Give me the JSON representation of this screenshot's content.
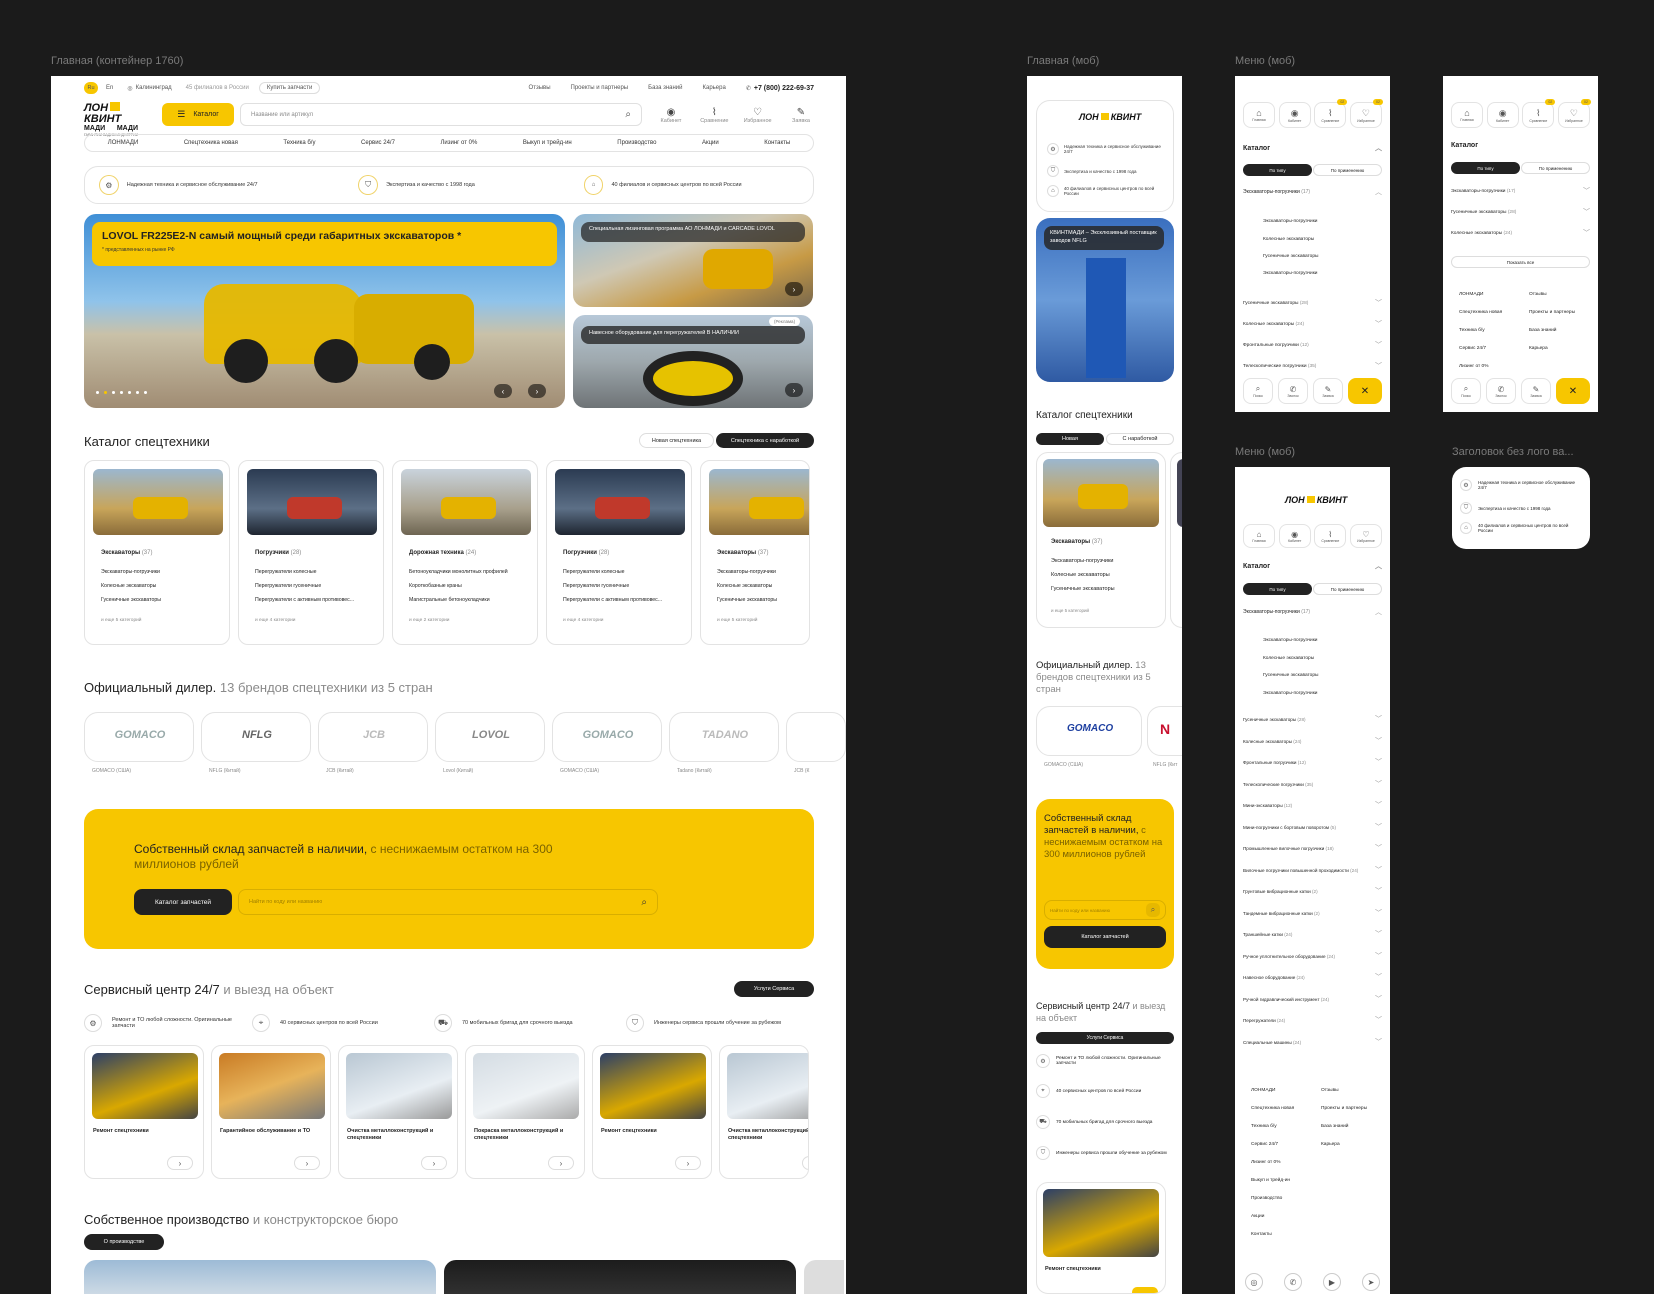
{
  "frame_labels": {
    "main_desktop": "Главная (контейнер 1760)",
    "main_mobile": "Главная (моб)",
    "menu_mobile_1": "Меню (моб)",
    "menu_mobile_2": "Меню (моб)",
    "header_no_logo": "Заголовок без лого ва..."
  },
  "topbar": {
    "lang_ru": "Ru",
    "lang_en": "En",
    "city": "Калининград",
    "branches": "45 филиалов в России",
    "buy_parts": "Купить запчасти",
    "links": [
      "Отзывы",
      "Проекты и партнеры",
      "База знаний",
      "Карьера"
    ],
    "phone": "+7 (800) 222-69-37"
  },
  "logo": {
    "line1": "ЛОН",
    "line2": "МАДИ",
    "line3": "КВИНТ",
    "line4": "МАДИ",
    "tagline": "ГАРАНТИИ ВАДИМ ИНДУСТРИИ"
  },
  "header": {
    "catalog_button": "Каталог",
    "search_placeholder": "Название или артикул",
    "actions": [
      {
        "label": "Кабинет",
        "icon": "user-icon"
      },
      {
        "label": "Сравнение",
        "icon": "chart-icon"
      },
      {
        "label": "Избранное",
        "icon": "heart-icon"
      },
      {
        "label": "Заявка",
        "icon": "request-icon"
      }
    ]
  },
  "nav": [
    "ЛОНМАДИ",
    "Спецтехника новая",
    "Техника б/у",
    "Сервис 24/7",
    "Лизинг от 0%",
    "Выкуп и трейд-ин",
    "Производство",
    "Акции",
    "Контакты"
  ],
  "benefits": [
    "Надежная техника и сервисное обслуживание 24/7",
    "Экспертиза и качество с 1998 года",
    "40 филиалов и сервисных центров по всей России"
  ],
  "hero": {
    "title": "LOVOL FR225E2-N самый мощный среди габаритных экскаваторов *",
    "note": "* представленных на рынке РФ",
    "side1": "Специальная лизинговая программа АО ЛОНМАДИ и CARCADE LOVOL",
    "side2_tag": "Реклама",
    "side2": "Навесное оборудование для перегружателей В НАЛИЧИИ"
  },
  "catalog": {
    "title": "Каталог спецтехники",
    "tab_new": "Новая спецтехника",
    "tab_used": "Спецтехника с наработкой",
    "cards": [
      {
        "title": "Экскаваторы",
        "count": "(37)",
        "items": [
          "Экскаваторы-погрузчики",
          "Колесные экскаваторы",
          "Гусеничные экскаваторы"
        ],
        "more": "и еще 5 категорий"
      },
      {
        "title": "Погрузчики",
        "count": "(28)",
        "items": [
          "Перегружатели колесные",
          "Перегружатели гусеничные",
          "Перегружатели с активным противовес..."
        ],
        "more": "и еще 4 категории"
      },
      {
        "title": "Дорожная техника",
        "count": "(24)",
        "items": [
          "Бетоноукладчики монолитных профилей",
          "Короткобазные краны",
          "Магистральные бетоноукладчики"
        ],
        "more": "и еще 2 категории"
      },
      {
        "title": "Погрузчики",
        "count": "(28)",
        "items": [
          "Перегружатели колесные",
          "Перегружатели гусеничные",
          "Перегружатели с активным противовес..."
        ],
        "more": "и еще 4 категории"
      },
      {
        "title": "Экскаваторы",
        "count": "(37)",
        "items": [
          "Экскаваторы-погрузчики",
          "Колесные экскаваторы",
          "Гусеничные экскаваторы"
        ],
        "more": "и еще 5 категорий"
      }
    ]
  },
  "dealer": {
    "title": "Официальный дилер.",
    "subtitle": "13 брендов спецтехники из 5 стран",
    "brands": [
      {
        "logo": "GOMACO",
        "caption": "GOMACO (США)"
      },
      {
        "logo": "NFLG",
        "caption": "NFLG (Китай)"
      },
      {
        "logo": "JCB",
        "caption": "JCB (Китай)"
      },
      {
        "logo": "LOVOL",
        "caption": "Lovol (Китай)"
      },
      {
        "logo": "GOMACO",
        "caption": "GOMACO (США)"
      },
      {
        "logo": "TADANO",
        "caption": "Tadano (Китай)"
      },
      {
        "logo": "",
        "caption": "JCB (К"
      }
    ]
  },
  "parts": {
    "title": "Собственный склад запчастей в наличии,",
    "subtitle": "с неснижаемым остатком на 300 миллионов рублей",
    "button": "Каталог запчастей",
    "placeholder": "Найти по коду или названию"
  },
  "service": {
    "title": "Сервисный центр 24/7",
    "subtitle": "и выезд на объект",
    "button": "Услуги Сервиса",
    "benefits": [
      "Ремонт и ТО любой сложности. Оригинальные запчасти",
      "40 сервисных центров по всей России",
      "70 мобильных бригад для срочного выезда",
      "Инженеры сервиса прошли обучение за рубежом"
    ],
    "cards": [
      "Ремонт спецтехники",
      "Гарантийное обслуживание и ТО",
      "Очистка металлоконструкций и спецтехники",
      "Покраска металлоконструкций и спецтехники",
      "Ремонт спецтехники",
      "Очистка металлоконструкций и спецтехники"
    ]
  },
  "production": {
    "title": "Собственное производство",
    "subtitle": "и конструкторское бюро",
    "button": "О производстве"
  },
  "mobile": {
    "benefits": [
      "Надежная техника и сервисное обслуживание 24/7",
      "Экспертиза и качество с 1998 года",
      "40 филиалов и сервисных центров по всей России"
    ],
    "hero": "КВИНТМАДИ – Эксклюзивный поставщик заводов NFLG",
    "catalog_title": "Каталог спецтехники",
    "tab_new": "Новая",
    "tab_used": "С наработкой",
    "card_title": "Экскаваторы",
    "card_count": "(37)",
    "card_items": [
      "Экскаваторы-погрузчики",
      "Колесные экскаваторы",
      "Гусеничные экскаваторы"
    ],
    "card_more": "и еще 5 категорий",
    "dealer_title": "Официальный дилер.",
    "dealer_subtitle": "13 брендов спецтехники из 5 стран",
    "brand_caption": "GOMACO (США)",
    "brand_caption2": "NFLG (Кит",
    "parts_title": "Собственный склад запчастей в наличии,",
    "parts_subtitle": "с неснижаемым остатком на 300 миллионов рублей",
    "parts_placeholder": "Найти по коду или названию",
    "parts_button": "Каталог запчастей",
    "service_title": "Сервисный центр 24/7",
    "service_subtitle": "и выезд на объект",
    "service_button": "Услуги Сервиса",
    "service_benefits": [
      "Ремонт и ТО любой сложности. Оригинальные запчасти",
      "40 сервисных центров по всей России",
      "70 мобильных бригад для срочного выезда",
      "Инженеры сервиса прошли обучение за рубежом"
    ],
    "service_card": "Ремонт спецтехники"
  },
  "menu": {
    "tabs": [
      "Главная",
      "Кабинет",
      "Сравнение",
      "Избранное"
    ],
    "badges": [
      "02",
      "02"
    ],
    "catalog": "Каталог",
    "by_type": "По типу",
    "by_use": "По применению",
    "open_group": "Экскаваторы-погрузчики",
    "open_group_count": "(17)",
    "sub_items": [
      "Экскаваторы-погрузчики",
      "Колесные экскаваторы",
      "Гусеничные экскаваторы",
      "Экскаваторы-погрузчики"
    ],
    "groups_short": [
      {
        "label": "Гусеничные экскаваторы",
        "count": "(28)"
      },
      {
        "label": "Колесные экскаваторы",
        "count": "(24)"
      },
      {
        "label": "Фронтальные погрузчики",
        "count": "(12)"
      },
      {
        "label": "Телескопические погрузчики",
        "count": "(35)"
      }
    ],
    "groups_long": [
      {
        "label": "Гусеничные экскаваторы",
        "count": "(28)"
      },
      {
        "label": "Колесные экскаваторы",
        "count": "(24)"
      },
      {
        "label": "Фронтальные погрузчики",
        "count": "(12)"
      },
      {
        "label": "Телескопические погрузчики",
        "count": "(35)"
      },
      {
        "label": "Мини-экскаваторы",
        "count": "(12)"
      },
      {
        "label": "Мини-погрузчики с бортовым поворотом",
        "count": "(5)"
      },
      {
        "label": "Промышленные вилочные погрузчики",
        "count": "(18)"
      },
      {
        "label": "Вилочные погрузчики повышенной проходимости",
        "count": "(24)"
      },
      {
        "label": "Грунтовые вибрационные катки",
        "count": "(2)"
      },
      {
        "label": "Тандемные вибрационные катки",
        "count": "(2)"
      },
      {
        "label": "Траншейные катки",
        "count": "(24)"
      },
      {
        "label": "Ручное уплотнительное оборудование",
        "count": "(24)"
      },
      {
        "label": "Навесное оборудование",
        "count": "(24)"
      },
      {
        "label": "Ручной гидравлический инструмент",
        "count": "(24)"
      },
      {
        "label": "Перегружатели",
        "count": "(24)"
      },
      {
        "label": "Специальные машины",
        "count": "(24)"
      }
    ],
    "collapsed": [
      {
        "label": "Экскаваторы-погрузчики",
        "count": "(17)"
      },
      {
        "label": "Гусеничные экскаваторы",
        "count": "(28)"
      },
      {
        "label": "Колесные экскаваторы",
        "count": "(24)"
      }
    ],
    "show_all": "Показать все",
    "links_left": [
      "ЛОНМАДИ",
      "Спецтехника новая",
      "Техника б/у",
      "Сервис 24/7",
      "Лизинг от 0%",
      "Выкуп и трейд-ин",
      "Производство",
      "Акции",
      "Контакты"
    ],
    "links_right": [
      "Отзывы",
      "Проекты и партнеры",
      "База знаний",
      "Карьера"
    ],
    "bottom": [
      "Поиск",
      "Звонок",
      "Заявка"
    ]
  },
  "colors": {
    "accent": "#f7c600",
    "dark": "#222222",
    "bg": "#1b1b1b"
  }
}
